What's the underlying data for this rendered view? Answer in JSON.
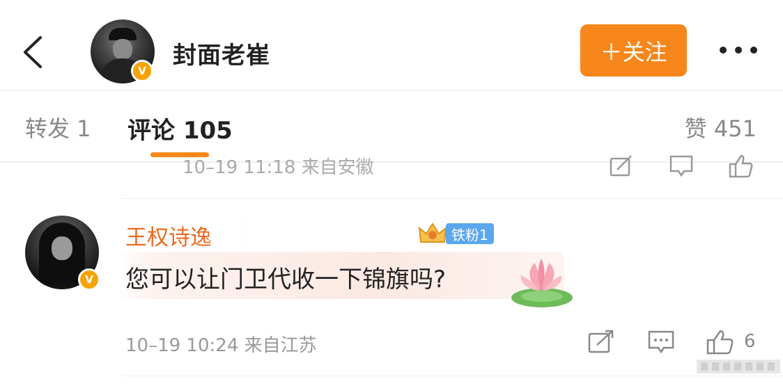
{
  "header": {
    "username": "封面老崔",
    "follow_label": "＋关注",
    "verified_badge": "V"
  },
  "tabs": {
    "repost": "转发 1",
    "comment": "评论 105",
    "like": "赞 451"
  },
  "prev_comment": {
    "meta": "10–19 11:18 来自安徽"
  },
  "comment": {
    "author": "王权诗逸",
    "fan_badge": "铁粉1",
    "verified_badge": "V",
    "text": "您可以让门卫代收一下锦旗吗?",
    "meta": "10–19 10:24 来自江苏",
    "like_count": "6"
  },
  "colors": {
    "accent": "#f7861b",
    "name": "#e86a1f",
    "fan_badge": "#5aa7ee",
    "verified": "#f5a300"
  },
  "icons": [
    "back-icon",
    "more-icon",
    "share-icon",
    "comment-icon",
    "like-icon",
    "crown-icon",
    "lotus-sticker-icon"
  ]
}
